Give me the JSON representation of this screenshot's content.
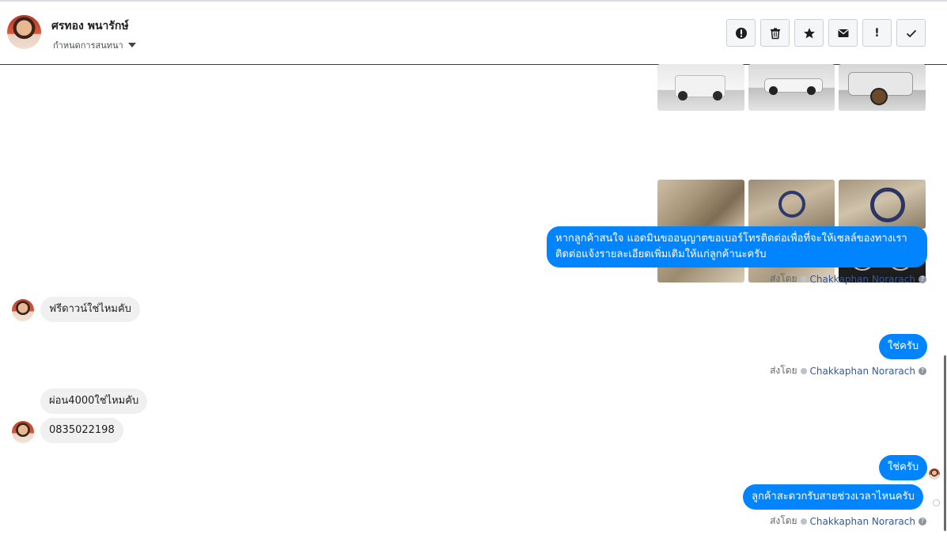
{
  "header": {
    "contact_name": "ศรทอง พนารักษ์",
    "subline_label": "กำหนดการสนทนา",
    "toolbar": [
      {
        "name": "alert-circle-button",
        "icon": "alert-circle-icon"
      },
      {
        "name": "delete-button",
        "icon": "trash-icon"
      },
      {
        "name": "star-button",
        "icon": "star-icon"
      },
      {
        "name": "mark-unread-button",
        "icon": "envelope-icon"
      },
      {
        "name": "important-button",
        "icon": "exclamation-icon"
      },
      {
        "name": "done-button",
        "icon": "check-icon"
      }
    ]
  },
  "messages": {
    "m1": "หากลูกค้าสนใจ แอดมินขออนุญาตขอเบอร์โทรติดต่อเพื่อที่จะให้เซลล์ของทางเรา",
    "m1b": "ติดต่อแจ้งรายละเอียดเพิ่มเติมให้แก่ลูกค้านะครับ",
    "m2": "ฟรีดาวน์ใช่ไหมคับ",
    "m3": "ใช่ครับ",
    "m4": "ผ่อน4000ใช่ไหมคับ",
    "m5": "0835022198",
    "m6": "ใช่ครับ",
    "m7": "ลูกค้าสะดวกรับสายช่วงเวลาไหนครับ"
  },
  "sent_by": {
    "label": "ส่งโดย",
    "agent": "Chakkaphan Norarach"
  },
  "colors": {
    "outgoing_bubble": "#0084ff",
    "incoming_bubble": "#f1f0f0",
    "agent_link": "#365899"
  }
}
